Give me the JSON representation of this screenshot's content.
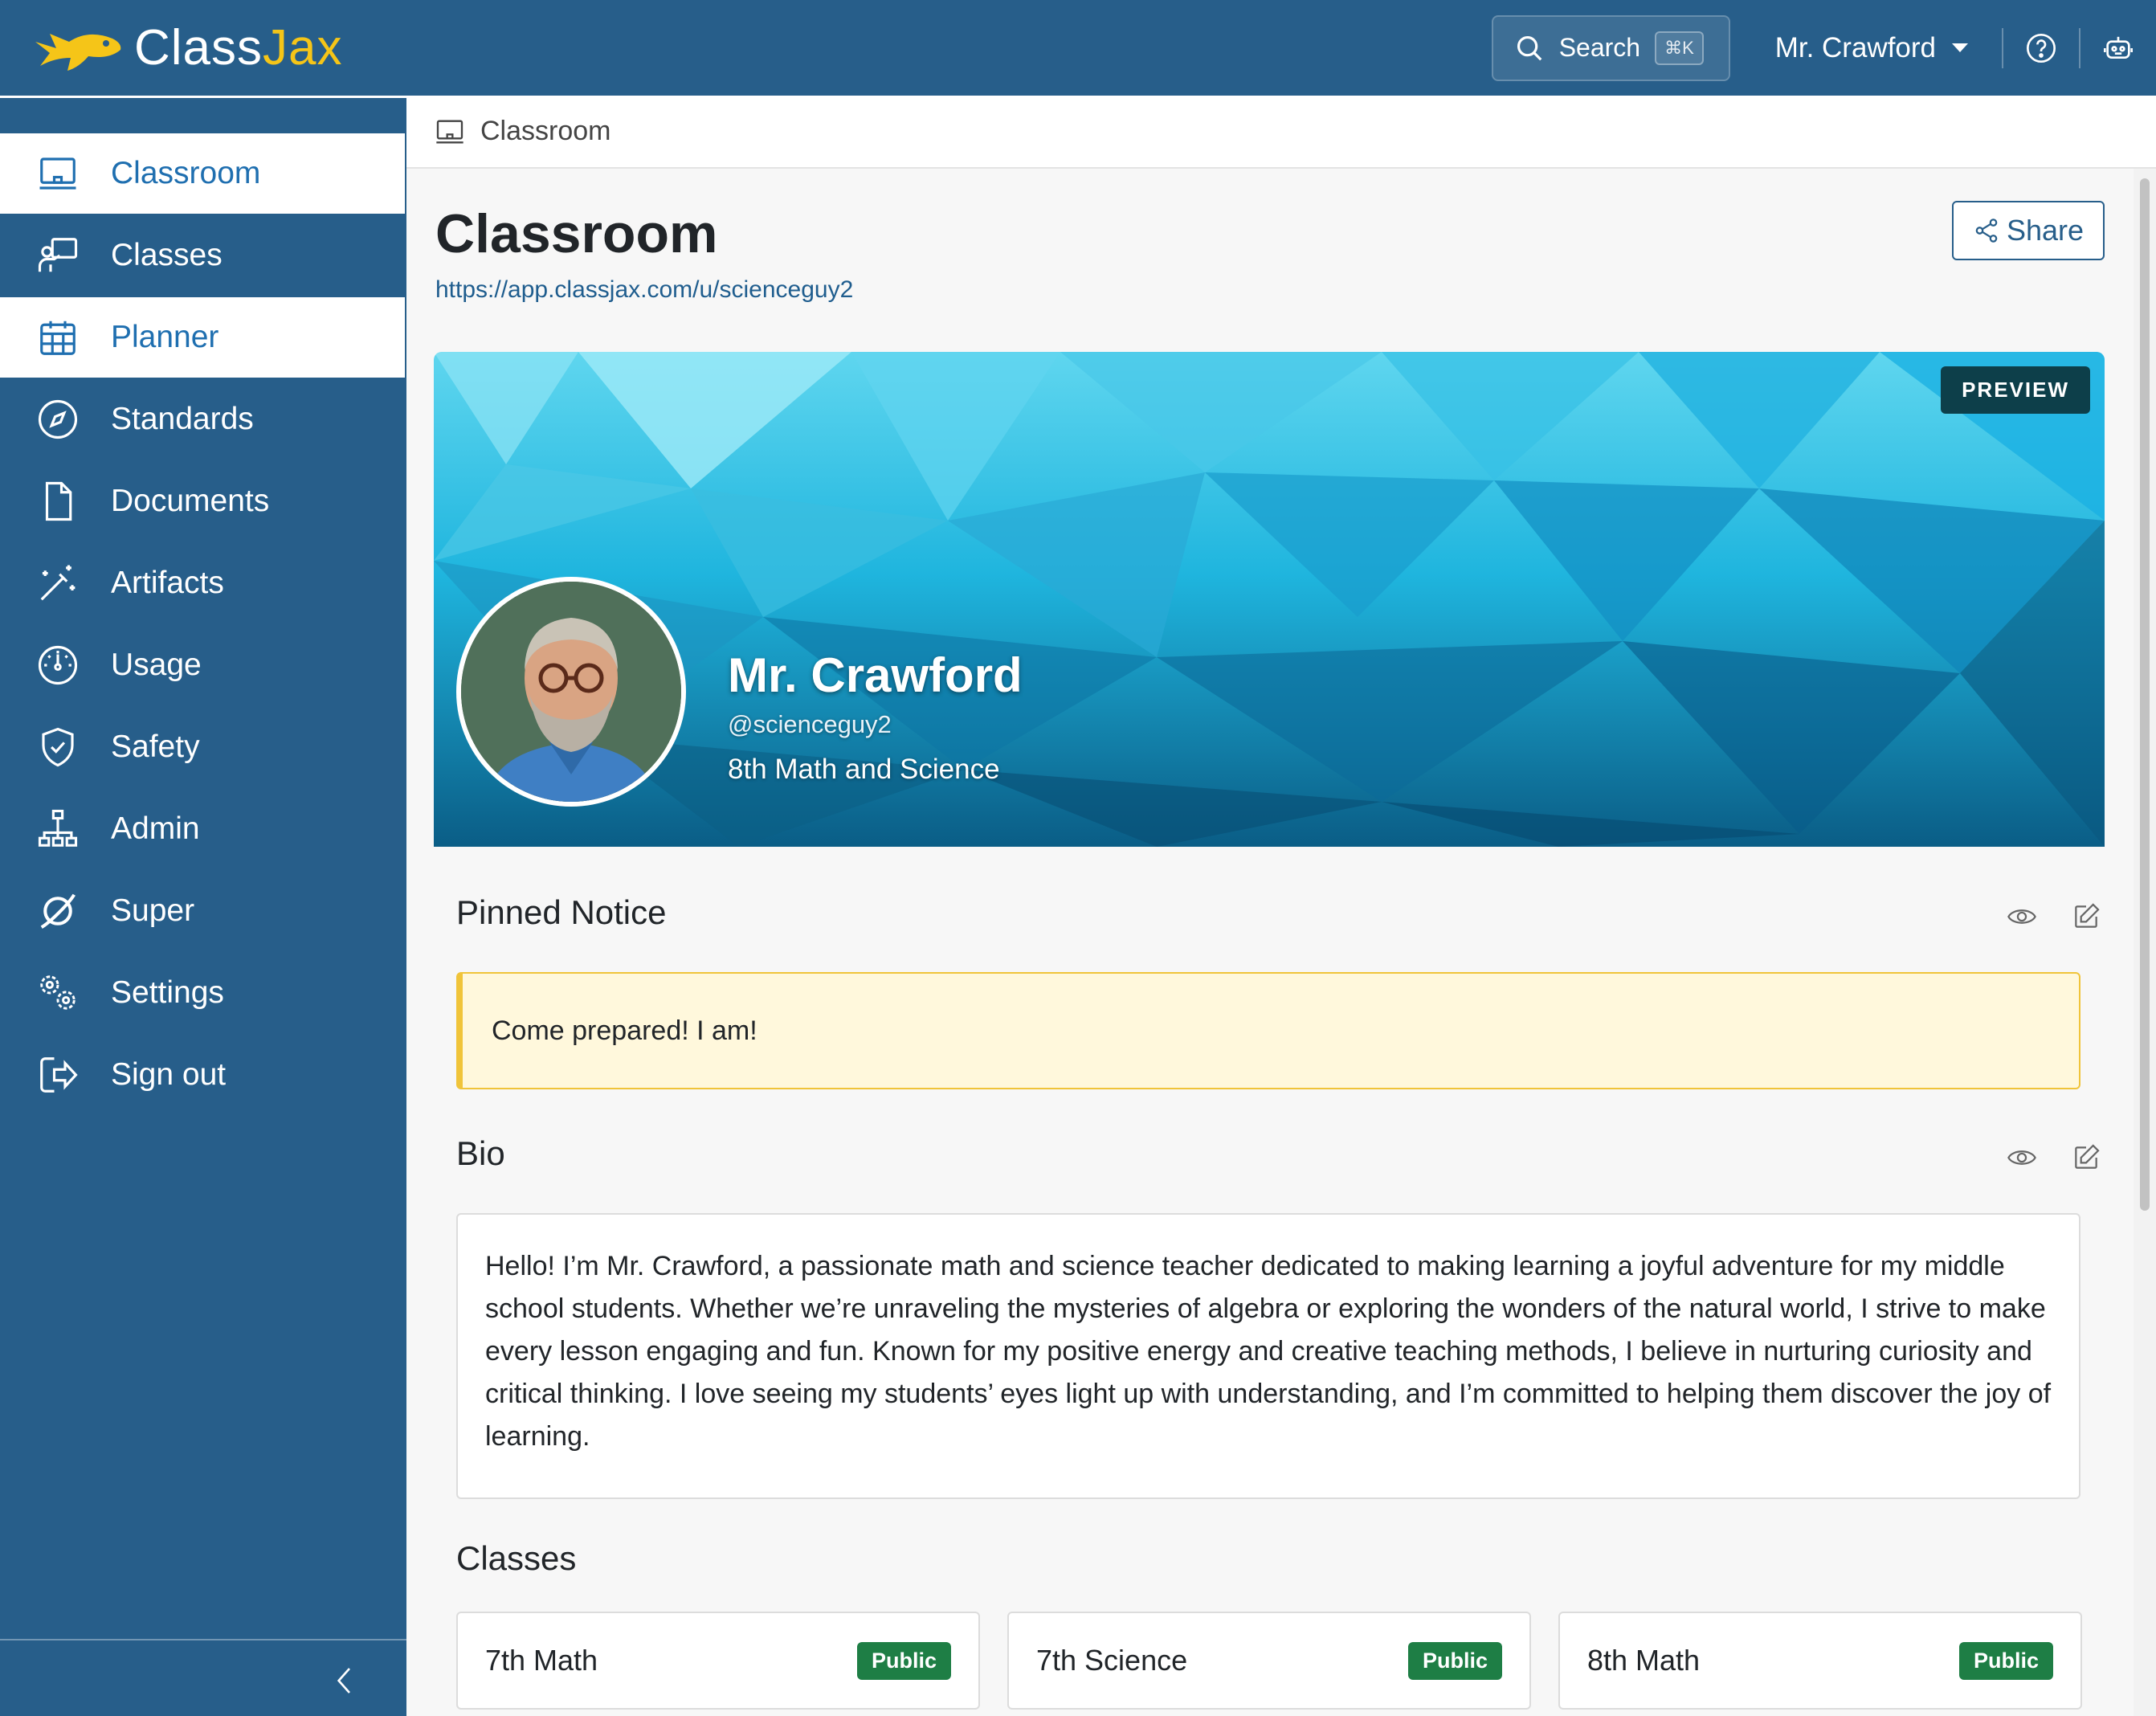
{
  "brand": {
    "name_part1": "Class",
    "name_part2": "Jax",
    "accent": "#f5c518"
  },
  "topbar": {
    "search_label": "Search",
    "search_shortcut": "⌘K",
    "user_name": "Mr. Crawford",
    "help_icon": "question-circle-icon",
    "robot_icon": "robot-icon",
    "color": "#275e8a"
  },
  "sidebar": {
    "items": [
      {
        "label": "Classroom",
        "icon": "monitor-icon",
        "active": true
      },
      {
        "label": "Classes",
        "icon": "teacher-board-icon",
        "active": false
      },
      {
        "label": "Planner",
        "icon": "calendar-icon",
        "active": true
      },
      {
        "label": "Standards",
        "icon": "compass-icon",
        "active": false
      },
      {
        "label": "Documents",
        "icon": "document-icon",
        "active": false
      },
      {
        "label": "Artifacts",
        "icon": "magic-wand-icon",
        "active": false
      },
      {
        "label": "Usage",
        "icon": "gauge-icon",
        "active": false
      },
      {
        "label": "Safety",
        "icon": "shield-check-icon",
        "active": false
      },
      {
        "label": "Admin",
        "icon": "org-chart-icon",
        "active": false
      },
      {
        "label": "Super",
        "icon": "orbit-icon",
        "active": false
      },
      {
        "label": "Settings",
        "icon": "gears-icon",
        "active": false
      },
      {
        "label": "Sign out",
        "icon": "sign-out-icon",
        "active": false
      }
    ],
    "collapse_icon": "chevron-left-icon"
  },
  "breadcrumb": {
    "label": "Classroom"
  },
  "page": {
    "title": "Classroom",
    "url": "https://app.classjax.com/u/scienceguy2",
    "share_label": "Share"
  },
  "hero": {
    "badge": "PREVIEW",
    "name": "Mr. Crawford",
    "handle": "@scienceguy2",
    "subject": "8th Math and Science"
  },
  "pinned": {
    "title": "Pinned Notice",
    "text": "Come prepared! I am!"
  },
  "bio": {
    "title": "Bio",
    "text": "Hello! I’m Mr. Crawford, a passionate math and science teacher dedicated to making learning a joyful adventure for my middle school students. Whether we’re unraveling the mysteries of algebra or exploring the wonders of the natural world, I strive to make every lesson engaging and fun. Known for my positive energy and creative teaching methods, I believe in nurturing curiosity and critical thinking. I love seeing my students’ eyes light up with understanding, and I’m committed to helping them discover the joy of learning."
  },
  "classes": {
    "title": "Classes",
    "items": [
      {
        "name": "7th Math",
        "visibility": "Public"
      },
      {
        "name": "7th Science",
        "visibility": "Public"
      },
      {
        "name": "8th Math",
        "visibility": "Public"
      }
    ]
  }
}
